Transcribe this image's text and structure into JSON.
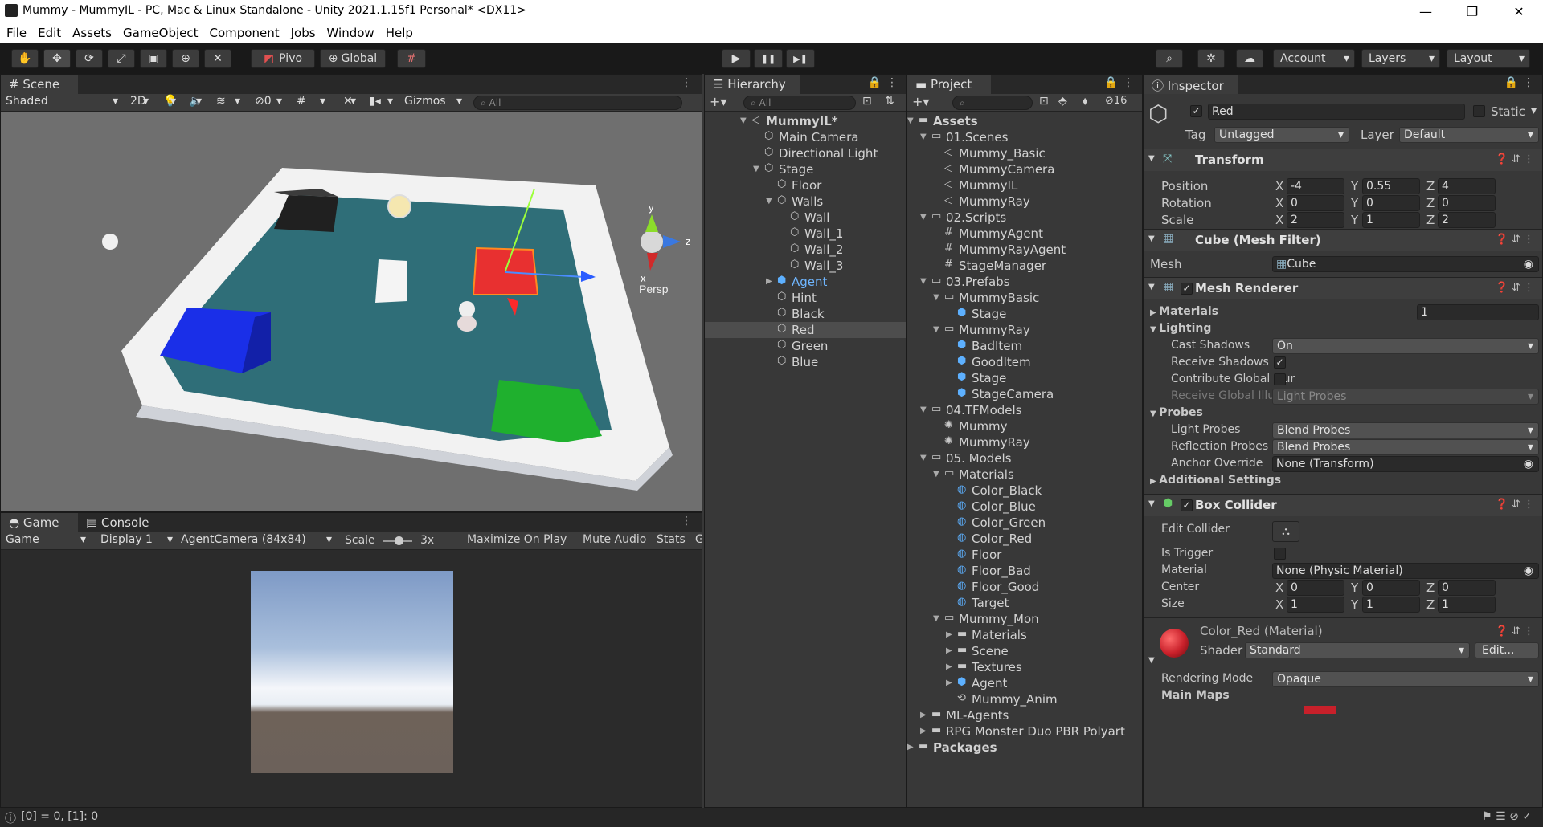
{
  "window": {
    "title": "Mummy - MummyIL - PC, Mac & Linux Standalone - Unity 2021.1.15f1 Personal* <DX11>",
    "minimize": "—",
    "maximize": "❐",
    "close": "✕"
  },
  "menu": [
    "File",
    "Edit",
    "Assets",
    "GameObject",
    "Component",
    "Jobs",
    "Window",
    "Help"
  ],
  "toolbar": {
    "pivot": "Pivo",
    "global": "Global",
    "play": "▶",
    "pause": "❚❚",
    "step": "▶❚",
    "account": "Account",
    "layers": "Layers",
    "layout": "Layout"
  },
  "scene": {
    "tab": "Scene",
    "shading": "Shaded",
    "mode2d": "2D",
    "hidden_count": "0",
    "gizmos": "Gizmos",
    "search": "All",
    "persp": "Persp",
    "axis_y": "y",
    "axis_x": "x",
    "axis_z": "z"
  },
  "game": {
    "tab_game": "Game",
    "tab_console": "Console",
    "game_dd": "Game",
    "display": "Display 1",
    "camera": "AgentCamera (84x84)",
    "scale_label": "Scale",
    "scale_value": "3x",
    "maximize": "Maximize On Play",
    "mute": "Mute Audio",
    "stats": "Stats",
    "gizmos_cut": "G"
  },
  "hierarchy": {
    "tab": "Hierarchy",
    "search": "All",
    "items": [
      {
        "label": "MummyIL*",
        "depth": 0,
        "arrow": "▼",
        "icon": "◁",
        "bold": true
      },
      {
        "label": "Main Camera",
        "depth": 1,
        "arrow": "",
        "icon": "⬡"
      },
      {
        "label": "Directional Light",
        "depth": 1,
        "arrow": "",
        "icon": "⬡"
      },
      {
        "label": "Stage",
        "depth": 1,
        "arrow": "▼",
        "icon": "⬡"
      },
      {
        "label": "Floor",
        "depth": 2,
        "arrow": "",
        "icon": "⬡"
      },
      {
        "label": "Walls",
        "depth": 2,
        "arrow": "▼",
        "icon": "⬡"
      },
      {
        "label": "Wall",
        "depth": 3,
        "arrow": "",
        "icon": "⬡"
      },
      {
        "label": "Wall_1",
        "depth": 3,
        "arrow": "",
        "icon": "⬡"
      },
      {
        "label": "Wall_2",
        "depth": 3,
        "arrow": "",
        "icon": "⬡"
      },
      {
        "label": "Wall_3",
        "depth": 3,
        "arrow": "",
        "icon": "⬡"
      },
      {
        "label": "Agent",
        "depth": 2,
        "arrow": "▶",
        "icon": "⬢",
        "blue": true
      },
      {
        "label": "Hint",
        "depth": 2,
        "arrow": "",
        "icon": "⬡"
      },
      {
        "label": "Black",
        "depth": 2,
        "arrow": "",
        "icon": "⬡"
      },
      {
        "label": "Red",
        "depth": 2,
        "arrow": "",
        "icon": "⬡",
        "selected": true
      },
      {
        "label": "Green",
        "depth": 2,
        "arrow": "",
        "icon": "⬡"
      },
      {
        "label": "Blue",
        "depth": 2,
        "arrow": "",
        "icon": "⬡"
      }
    ]
  },
  "project": {
    "tab": "Project",
    "search": "",
    "hidden_count": "16",
    "items": [
      {
        "label": "Assets",
        "depth": 0,
        "arrow": "▼",
        "icon": "▬",
        "bold": true
      },
      {
        "label": "01.Scenes",
        "depth": 1,
        "arrow": "▼",
        "icon": "▭"
      },
      {
        "label": "Mummy_Basic",
        "depth": 2,
        "arrow": "",
        "icon": "◁"
      },
      {
        "label": "MummyCamera",
        "depth": 2,
        "arrow": "",
        "icon": "◁"
      },
      {
        "label": "MummyIL",
        "depth": 2,
        "arrow": "",
        "icon": "◁"
      },
      {
        "label": "MummyRay",
        "depth": 2,
        "arrow": "",
        "icon": "◁"
      },
      {
        "label": "02.Scripts",
        "depth": 1,
        "arrow": "▼",
        "icon": "▭"
      },
      {
        "label": "MummyAgent",
        "depth": 2,
        "arrow": "",
        "icon": "#"
      },
      {
        "label": "MummyRayAgent",
        "depth": 2,
        "arrow": "",
        "icon": "#"
      },
      {
        "label": "StageManager",
        "depth": 2,
        "arrow": "",
        "icon": "#"
      },
      {
        "label": "03.Prefabs",
        "depth": 1,
        "arrow": "▼",
        "icon": "▭"
      },
      {
        "label": "MummyBasic",
        "depth": 2,
        "arrow": "▼",
        "icon": "▭"
      },
      {
        "label": "Stage",
        "depth": 3,
        "arrow": "",
        "icon": "⬢",
        "blue": true
      },
      {
        "label": "MummyRay",
        "depth": 2,
        "arrow": "▼",
        "icon": "▭"
      },
      {
        "label": "BadItem",
        "depth": 3,
        "arrow": "",
        "icon": "⬢",
        "blue": true
      },
      {
        "label": "GoodItem",
        "depth": 3,
        "arrow": "",
        "icon": "⬢",
        "blue": true
      },
      {
        "label": "Stage",
        "depth": 3,
        "arrow": "",
        "icon": "⬢",
        "blue": true
      },
      {
        "label": "StageCamera",
        "depth": 3,
        "arrow": "",
        "icon": "⬢",
        "blue": true
      },
      {
        "label": "04.TFModels",
        "depth": 1,
        "arrow": "▼",
        "icon": "▭"
      },
      {
        "label": "Mummy",
        "depth": 2,
        "arrow": "",
        "icon": "✺"
      },
      {
        "label": "MummyRay",
        "depth": 2,
        "arrow": "",
        "icon": "✺"
      },
      {
        "label": "05. Models",
        "depth": 1,
        "arrow": "▼",
        "icon": "▭"
      },
      {
        "label": "Materials",
        "depth": 2,
        "arrow": "▼",
        "icon": "▭"
      },
      {
        "label": "Color_Black",
        "depth": 3,
        "arrow": "",
        "icon": "◍",
        "blue": true
      },
      {
        "label": "Color_Blue",
        "depth": 3,
        "arrow": "",
        "icon": "◍",
        "blue": true
      },
      {
        "label": "Color_Green",
        "depth": 3,
        "arrow": "",
        "icon": "◍",
        "blue": true
      },
      {
        "label": "Color_Red",
        "depth": 3,
        "arrow": "",
        "icon": "◍",
        "blue": true
      },
      {
        "label": "Floor",
        "depth": 3,
        "arrow": "",
        "icon": "◍",
        "blue": true
      },
      {
        "label": "Floor_Bad",
        "depth": 3,
        "arrow": "",
        "icon": "◍",
        "blue": true
      },
      {
        "label": "Floor_Good",
        "depth": 3,
        "arrow": "",
        "icon": "◍",
        "blue": true
      },
      {
        "label": "Target",
        "depth": 3,
        "arrow": "",
        "icon": "◍",
        "blue": true
      },
      {
        "label": "Mummy_Mon",
        "depth": 2,
        "arrow": "▼",
        "icon": "▭"
      },
      {
        "label": "Materials",
        "depth": 3,
        "arrow": "▶",
        "icon": "▬"
      },
      {
        "label": "Scene",
        "depth": 3,
        "arrow": "▶",
        "icon": "▬"
      },
      {
        "label": "Textures",
        "depth": 3,
        "arrow": "▶",
        "icon": "▬"
      },
      {
        "label": "Agent",
        "depth": 3,
        "arrow": "▶",
        "icon": "⬢",
        "blue": true
      },
      {
        "label": "Mummy_Anim",
        "depth": 3,
        "arrow": "",
        "icon": "⟲"
      },
      {
        "label": "ML-Agents",
        "depth": 1,
        "arrow": "▶",
        "icon": "▬"
      },
      {
        "label": "RPG Monster Duo PBR Polyart",
        "depth": 1,
        "arrow": "▶",
        "icon": "▬"
      },
      {
        "label": "Packages",
        "depth": 0,
        "arrow": "▶",
        "icon": "▬",
        "bold": true
      }
    ]
  },
  "inspector": {
    "tab": "Inspector",
    "name": "Red",
    "static": "Static",
    "tag_label": "Tag",
    "tag": "Untagged",
    "layer_label": "Layer",
    "layer": "Default",
    "transform": {
      "title": "Transform",
      "position": "Position",
      "rotation": "Rotation",
      "scale": "Scale",
      "x": "X",
      "y": "Y",
      "z": "Z",
      "pos": [
        "-4",
        "0.55",
        "4"
      ],
      "rot": [
        "0",
        "0",
        "0"
      ],
      "scl": [
        "2",
        "1",
        "2"
      ]
    },
    "mesh_filter": {
      "title": "Cube (Mesh Filter)",
      "mesh_label": "Mesh",
      "mesh": "Cube"
    },
    "mesh_renderer": {
      "title": "Mesh Renderer",
      "materials": "Materials",
      "materials_count": "1",
      "lighting": "Lighting",
      "cast_shadows": "Cast Shadows",
      "cast_value": "On",
      "receive_shadows": "Receive Shadows",
      "contribute_gi": "Contribute Global Illur",
      "receive_gi": "Receive Global Illumii",
      "receive_gi_value": "Light Probes",
      "probes": "Probes",
      "light_probes": "Light Probes",
      "light_probes_value": "Blend Probes",
      "reflection_probes": "Reflection Probes",
      "reflection_value": "Blend Probes",
      "anchor": "Anchor Override",
      "anchor_value": "None (Transform)",
      "additional": "Additional Settings"
    },
    "box_collider": {
      "title": "Box Collider",
      "edit": "Edit Collider",
      "trigger": "Is Trigger",
      "material": "Material",
      "material_value": "None (Physic Material)",
      "center": "Center",
      "size": "Size",
      "ctr": [
        "0",
        "0",
        "0"
      ],
      "sz": [
        "1",
        "1",
        "1"
      ]
    },
    "material": {
      "title": "Color_Red (Material)",
      "shader_label": "Shader",
      "shader": "Standard",
      "edit": "Edit...",
      "rendering_mode": "Rendering Mode",
      "rendering_value": "Opaque",
      "main_maps": "Main Maps"
    }
  },
  "status": {
    "text": "[0] = 0, [1]: 0"
  },
  "colors": {
    "selection": "#4d4d4d",
    "accent_blue": "#5db0ff",
    "red_material": "#c8202a"
  }
}
